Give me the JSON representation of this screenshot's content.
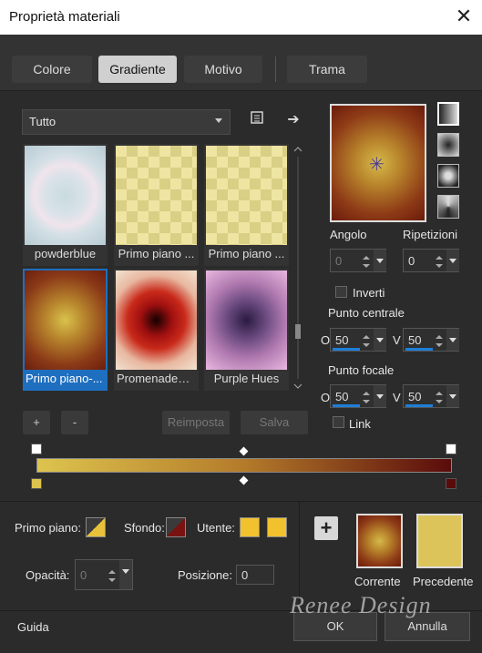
{
  "window": {
    "title": "Proprietà materiali",
    "close_glyph": "✕"
  },
  "tabs": [
    {
      "label": "Colore",
      "active": false
    },
    {
      "label": "Gradiente",
      "active": true
    },
    {
      "label": "Motivo",
      "active": false
    },
    {
      "label": "Trama",
      "active": false
    }
  ],
  "library": {
    "category_value": "Tutto",
    "thumbnails": [
      {
        "label": "powderblue",
        "selected": false
      },
      {
        "label": "Primo piano ...",
        "selected": false
      },
      {
        "label": "Primo piano ...",
        "selected": false
      },
      {
        "label": "Primo piano-...",
        "selected": true
      },
      {
        "label": "Promenade_I...",
        "selected": false
      },
      {
        "label": "Purple Hues",
        "selected": false
      }
    ],
    "add_label": "+",
    "remove_label": "-",
    "reset_label": "Reimposta",
    "save_label": "Salva"
  },
  "settings": {
    "angle_label": "Angolo",
    "angle_value": "0",
    "repeats_label": "Ripetizioni",
    "repeats_value": "0",
    "invert_label": "Inverti",
    "center_label": "Punto centrale",
    "center_h_label": "O",
    "center_h_value": "50",
    "center_v_label": "V",
    "center_v_value": "50",
    "focal_label": "Punto focale",
    "focal_h_label": "O",
    "focal_h_value": "50",
    "focal_v_label": "V",
    "focal_v_value": "50",
    "link_label": "Link"
  },
  "editor": {
    "foreground_label": "Primo piano:",
    "background_label": "Sfondo:",
    "user_label": "Utente:",
    "opacity_label": "Opacità:",
    "opacity_value": "0",
    "position_label": "Posizione:",
    "position_value": "0",
    "user_color": "#f2c12e"
  },
  "compare": {
    "add_label": "+",
    "current_label": "Corrente",
    "previous_label": "Precedente",
    "previous_color": "#dcc45a"
  },
  "footer": {
    "help_label": "Guida",
    "ok_label": "OK",
    "cancel_label": "Annulla",
    "watermark": "Renee Design"
  }
}
